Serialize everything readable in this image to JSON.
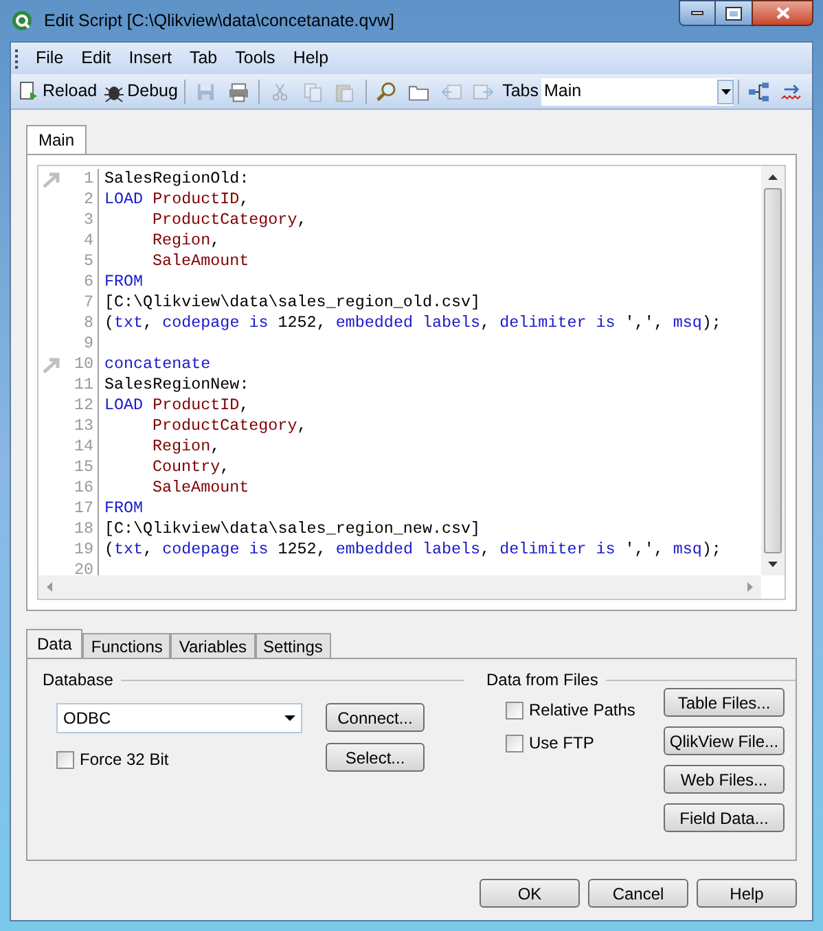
{
  "window": {
    "title": "Edit Script [C:\\Qlikview\\data\\concetanate.qvw]"
  },
  "menu": [
    "File",
    "Edit",
    "Insert",
    "Tab",
    "Tools",
    "Help"
  ],
  "toolbar": {
    "buttons": [
      {
        "label": "Reload",
        "disabled": false
      },
      {
        "label": "Debug",
        "disabled": false
      }
    ],
    "icons": [
      {
        "disabled": true
      },
      {
        "disabled": false
      },
      {
        "disabled": true
      },
      {
        "disabled": true
      },
      {
        "disabled": true
      },
      {
        "disabled": false
      },
      {
        "disabled": false
      },
      {
        "disabled": true
      },
      {
        "disabled": true
      }
    ],
    "tabs_label": "Tabs",
    "tabs_value": "Main"
  },
  "editor_tabs": [
    {
      "label": "Main",
      "selected": true
    }
  ],
  "code": [
    {
      "number": "1",
      "bookmark": true,
      "indented": false,
      "tokens": [
        {
          "text": "SalesRegionOld:",
          "kind": "plain"
        }
      ]
    },
    {
      "number": "2",
      "bookmark": false,
      "indented": false,
      "tokens": [
        {
          "text": "LOAD",
          "kind": "keyword"
        },
        {
          "text": "ProductID",
          "kind": "field",
          "space_before": true
        },
        {
          "text": ",",
          "kind": "plain"
        }
      ]
    },
    {
      "number": "3",
      "bookmark": false,
      "indented": true,
      "tokens": [
        {
          "text": "ProductCategory",
          "kind": "field"
        },
        {
          "text": ",",
          "kind": "plain"
        }
      ]
    },
    {
      "number": "4",
      "bookmark": false,
      "indented": true,
      "tokens": [
        {
          "text": "Region",
          "kind": "field"
        },
        {
          "text": ",",
          "kind": "plain"
        }
      ]
    },
    {
      "number": "5",
      "bookmark": false,
      "indented": true,
      "tokens": [
        {
          "text": "SaleAmount",
          "kind": "field"
        }
      ]
    },
    {
      "number": "6",
      "bookmark": false,
      "indented": false,
      "tokens": [
        {
          "text": "FROM",
          "kind": "keyword"
        }
      ]
    },
    {
      "number": "7",
      "bookmark": false,
      "indented": false,
      "tokens": [
        {
          "text": "[C:\\Qlikview\\data\\sales_region_old.csv]",
          "kind": "plain"
        }
      ]
    },
    {
      "number": "8",
      "bookmark": false,
      "indented": false,
      "tokens": [
        {
          "text": "(",
          "kind": "plain"
        },
        {
          "text": "txt",
          "kind": "keyword"
        },
        {
          "text": ", ",
          "kind": "plain"
        },
        {
          "text": "codepage is",
          "kind": "keyword"
        },
        {
          "text": " 1252, ",
          "kind": "plain"
        },
        {
          "text": "embedded labels",
          "kind": "keyword"
        },
        {
          "text": ", ",
          "kind": "plain"
        },
        {
          "text": "delimiter is",
          "kind": "keyword"
        },
        {
          "text": " ',', ",
          "kind": "plain"
        },
        {
          "text": "msq",
          "kind": "keyword"
        },
        {
          "text": ");",
          "kind": "plain"
        }
      ]
    },
    {
      "number": "9",
      "bookmark": false
    },
    {
      "number": "10",
      "bookmark": true,
      "indented": false,
      "tokens": [
        {
          "text": "concatenate",
          "kind": "keyword"
        }
      ]
    },
    {
      "number": "11",
      "bookmark": false,
      "indented": false,
      "tokens": [
        {
          "text": "SalesRegionNew:",
          "kind": "plain"
        }
      ]
    },
    {
      "number": "12",
      "bookmark": false,
      "indented": false,
      "tokens": [
        {
          "text": "LOAD",
          "kind": "keyword"
        },
        {
          "text": "ProductID",
          "kind": "field",
          "space_before": true
        },
        {
          "text": ",",
          "kind": "plain"
        }
      ]
    },
    {
      "number": "13",
      "bookmark": false,
      "indented": true,
      "tokens": [
        {
          "text": "ProductCategory",
          "kind": "field"
        },
        {
          "text": ",",
          "kind": "plain"
        }
      ]
    },
    {
      "number": "14",
      "bookmark": false,
      "indented": true,
      "tokens": [
        {
          "text": "Region",
          "kind": "field"
        },
        {
          "text": ",",
          "kind": "plain"
        }
      ]
    },
    {
      "number": "15",
      "bookmark": false,
      "indented": true,
      "tokens": [
        {
          "text": "Country",
          "kind": "field"
        },
        {
          "text": ",",
          "kind": "plain"
        }
      ]
    },
    {
      "number": "16",
      "bookmark": false,
      "indented": true,
      "tokens": [
        {
          "text": "SaleAmount",
          "kind": "field"
        }
      ]
    },
    {
      "number": "17",
      "bookmark": false,
      "indented": false,
      "tokens": [
        {
          "text": "FROM",
          "kind": "keyword"
        }
      ]
    },
    {
      "number": "18",
      "bookmark": false,
      "indented": false,
      "tokens": [
        {
          "text": "[C:\\Qlikview\\data\\sales_region_new.csv]",
          "kind": "plain"
        }
      ]
    },
    {
      "number": "19",
      "bookmark": false,
      "indented": false,
      "tokens": [
        {
          "text": "(",
          "kind": "plain"
        },
        {
          "text": "txt",
          "kind": "keyword"
        },
        {
          "text": ", ",
          "kind": "plain"
        },
        {
          "text": "codepage is",
          "kind": "keyword"
        },
        {
          "text": " 1252, ",
          "kind": "plain"
        },
        {
          "text": "embedded labels",
          "kind": "keyword"
        },
        {
          "text": ", ",
          "kind": "plain"
        },
        {
          "text": "delimiter is",
          "kind": "keyword"
        },
        {
          "text": " ',', ",
          "kind": "plain"
        },
        {
          "text": "msq",
          "kind": "keyword"
        },
        {
          "text": ");",
          "kind": "plain"
        }
      ]
    },
    {
      "number": "20",
      "bookmark": false
    }
  ],
  "panel_tabs": [
    {
      "label": "Data",
      "selected": true
    },
    {
      "label": "Functions",
      "selected": false
    },
    {
      "label": "Variables",
      "selected": false
    },
    {
      "label": "Settings",
      "selected": false
    }
  ],
  "database": {
    "legend": "Database",
    "value": "ODBC",
    "force32": {
      "label": "Force 32 Bit",
      "checked": false
    },
    "buttons": [
      "Connect...",
      "Select..."
    ]
  },
  "files": {
    "legend": "Data from Files",
    "options": [
      {
        "label": "Relative Paths",
        "checked": false
      },
      {
        "label": "Use FTP",
        "checked": false
      }
    ],
    "buttons": [
      "Table Files...",
      "QlikView File...",
      "Web Files...",
      "Field Data..."
    ]
  },
  "dialog_buttons": [
    "OK",
    "Cancel",
    "Help"
  ]
}
